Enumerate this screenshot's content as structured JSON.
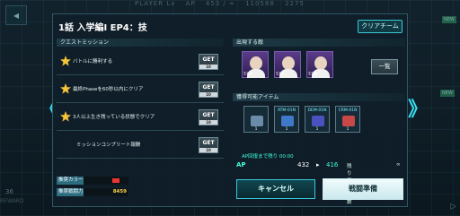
{
  "background": {
    "top_strip": [
      "PLAYER Lv",
      "AP",
      "453 / ∞",
      "110588",
      "2275"
    ],
    "bottom_left": "REWARD",
    "side_left_value": "36",
    "new_badge": "NEW",
    "bottom_right": "ᐅ"
  },
  "dialog": {
    "title": "1話 入学編Ⅰ EP4：技",
    "clear_team_label": "クリアチーム",
    "quest_section_label": "クエストミッション",
    "enemy_section_label": "出現する敵",
    "item_section_label": "獲得可能アイテム",
    "missions": [
      {
        "text": "バトルに勝利する",
        "button": "GET",
        "sub": "10"
      },
      {
        "text": "最終Phaseを60秒以内にクリア",
        "button": "GET",
        "sub": "10"
      },
      {
        "text": "3人以上生き残っている状態でクリア",
        "button": "GET",
        "sub": "10"
      },
      {
        "text": "ミッションコンプリート報酬",
        "button": "GET",
        "sub": "10"
      }
    ],
    "recommend_color_label": "推奨カラー",
    "recommend_power_label": "推奨戦闘力",
    "recommend_power_value": "8459",
    "enemies": [
      {
        "name": "生徒会"
      },
      {
        "name": "生徒会"
      },
      {
        "name": "生徒会"
      }
    ],
    "list_button_label": "一覧",
    "items": [
      {
        "label": "",
        "count": "1",
        "color": "#6b8ba8"
      },
      {
        "label": "ATM-01N",
        "count": "1",
        "color": "#3f78c8"
      },
      {
        "label": "DEM-01N",
        "count": "1",
        "color": "#4a52c0"
      },
      {
        "label": "CRM-01N",
        "count": "1",
        "color": "#c84848"
      }
    ],
    "ap_recover_text": "AP回復まで残り 00:00",
    "ap_label": "AP",
    "ap_from": "432",
    "ap_arrow": "▸",
    "ap_to": "416",
    "retry_label": "残り挑戦回数",
    "retry_value": "∞",
    "cancel_label": "キャンセル",
    "start_label": "戦闘準備"
  }
}
